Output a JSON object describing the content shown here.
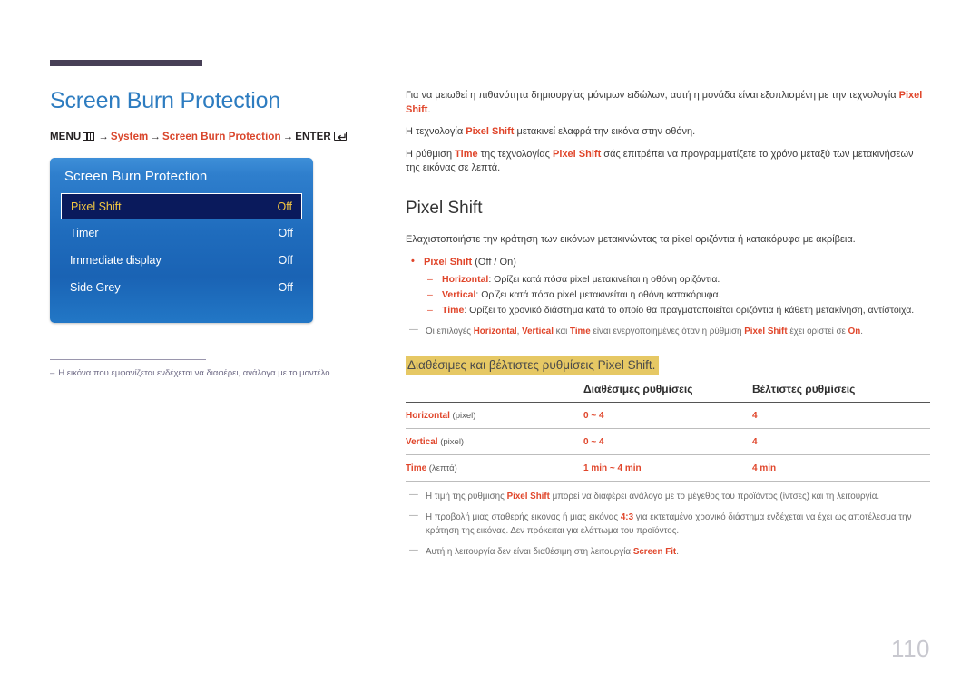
{
  "top_rule": {
    "bar_color": "#473f56",
    "line_color": "#8a8a8a"
  },
  "left": {
    "title": "Screen Burn Protection",
    "breadcrumb": {
      "menu_label": "MENU",
      "menu_icon": "menu-grid-icon",
      "arrow": "→",
      "item1": "System",
      "item2": "Screen Burn Protection",
      "enter_label": "ENTER",
      "enter_icon": "enter-return-icon"
    },
    "osd": {
      "title": "Screen Burn Protection",
      "rows": [
        {
          "label": "Pixel Shift",
          "value": "Off",
          "selected": true
        },
        {
          "label": "Timer",
          "value": "Off",
          "selected": false
        },
        {
          "label": "Immediate display",
          "value": "Off",
          "selected": false
        },
        {
          "label": "Side Grey",
          "value": "Off",
          "selected": false
        }
      ]
    },
    "footnote": {
      "dash": "–",
      "text": "Η εικόνα που εμφανίζεται ενδέχεται να διαφέρει, ανάλογα με το μοντέλο."
    }
  },
  "right": {
    "intro": {
      "p1_a": "Για να μειωθεί η πιθανότητα δημιουργίας μόνιμων ειδώλων, αυτή η μονάδα είναι εξοπλισμένη με την τεχνολογία ",
      "p1_b": "Pixel Shift",
      "p1_c": ".",
      "p2_a": "Η τεχνολογία ",
      "p2_b": "Pixel Shift",
      "p2_c": " μετακινεί ελαφρά την εικόνα στην οθόνη.",
      "p3_a": "Η ρύθμιση ",
      "p3_b": "Time",
      "p3_c": " της τεχνολογίας ",
      "p3_d": "Pixel Shift",
      "p3_e": " σάς επιτρέπει να προγραμματίζετε το χρόνο μεταξύ των μετακινήσεων της εικόνας σε λεπτά."
    },
    "section_title": "Pixel Shift",
    "lead": "Ελαχιστοποιήστε την κράτηση των εικόνων μετακινώντας τα pixel οριζόντια ή κατακόρυφα με ακρίβεια.",
    "bullet": {
      "label": "Pixel Shift",
      "options": " (Off / On)",
      "sub": [
        {
          "term": "Horizontal",
          "text": ": Ορίζει κατά πόσα pixel μετακινείται η οθόνη οριζόντια."
        },
        {
          "term": "Vertical",
          "text": ": Ορίζει κατά πόσα pixel μετακινείται η οθόνη κατακόρυφα."
        },
        {
          "term": "Time",
          "text": ": Ορίζει το χρονικό διάστημα κατά το οποίο θα πραγματοποιείται οριζόντια ή κάθετη μετακίνηση, αντίστοιχα."
        }
      ]
    },
    "note_enabled": {
      "a": "Οι επιλογές ",
      "b": "Horizontal",
      "c": ", ",
      "d": "Vertical",
      "e": " και ",
      "f": "Time",
      "g": " είναι ενεργοποιημένες όταν η ρύθμιση ",
      "h": "Pixel Shift",
      "i": " έχει οριστεί σε ",
      "j": "On",
      "k": "."
    },
    "highlight_heading": "Διαθέσιμες και βέλτιστες ρυθμίσεις Pixel Shift.",
    "table": {
      "headers": [
        "",
        "Διαθέσιμες ρυθμίσεις",
        "Βέλτιστες ρυθμίσεις"
      ],
      "rows": [
        {
          "name": "Horizontal",
          "unit": " (pixel)",
          "available": "0 ~ 4",
          "optimal": "4"
        },
        {
          "name": "Vertical",
          "unit": "  (pixel)",
          "available": "0 ~ 4",
          "optimal": "4"
        },
        {
          "name": "Time",
          "unit": " (λεπτά)",
          "available": "1 min ~ 4 min",
          "optimal": "4 min"
        }
      ]
    },
    "bottom_notes": [
      {
        "a": "Η τιμή της ρύθμισης ",
        "b": "Pixel Shift",
        "c": " μπορεί να διαφέρει ανάλογα με το μέγεθος του προϊόντος (ίντσες) και τη λειτουργία."
      },
      {
        "a": "Η προβολή μιας σταθερής εικόνας ή μιας εικόνας ",
        "b": "4:3",
        "c": " για εκτεταμένο χρονικό διάστημα ενδέχεται να έχει ως αποτέλεσμα την κράτηση της εικόνας. Δεν πρόκειται για ελάττωμα του προϊόντος."
      },
      {
        "a": "Αυτή η λειτουργία δεν είναι διαθέσιμη στη λειτουργία ",
        "b": "Screen Fit",
        "c": "."
      }
    ]
  },
  "page_number": "110"
}
